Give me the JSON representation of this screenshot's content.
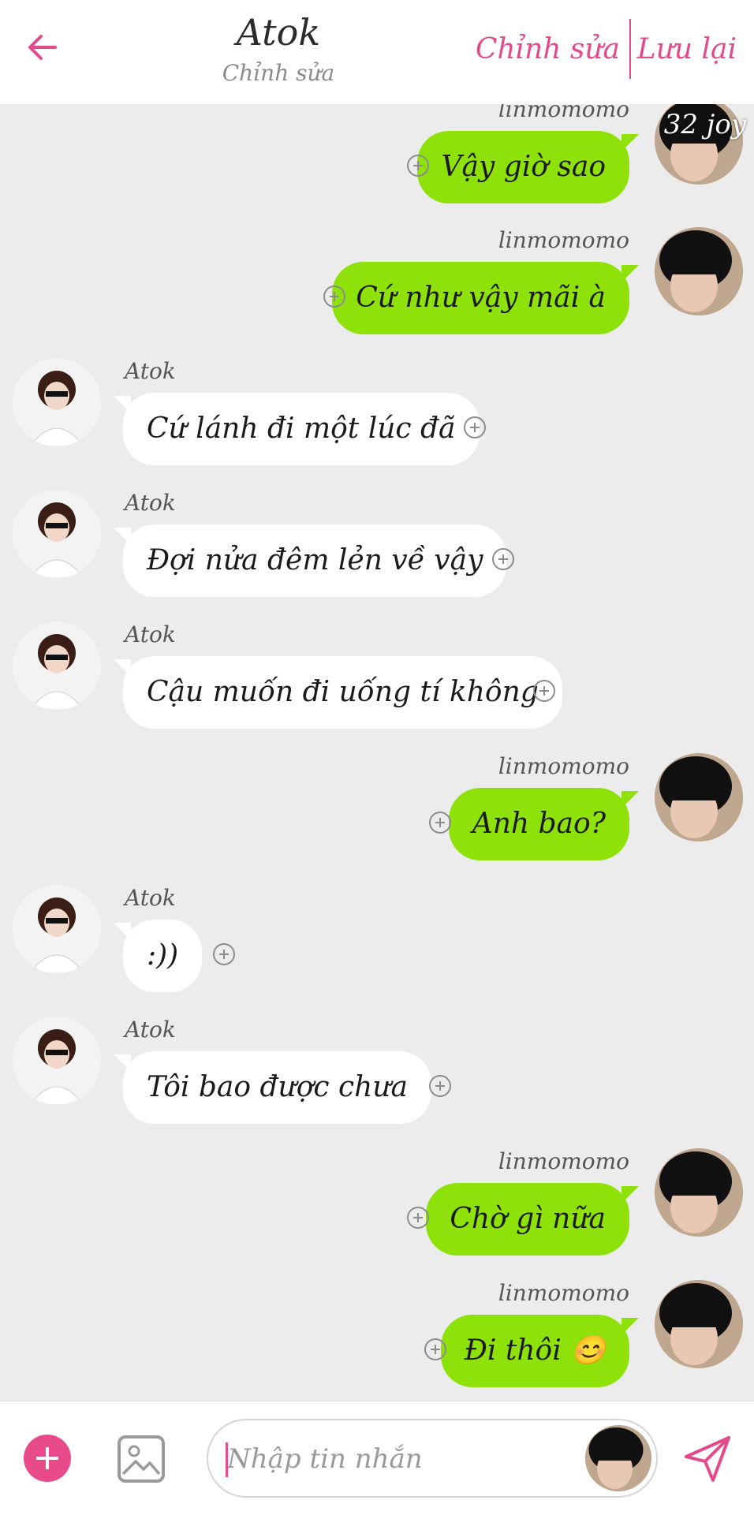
{
  "header": {
    "title": "Atok",
    "subtitle": "Chỉnh sửa",
    "edit_label": "Chỉnh sửa",
    "save_label": "Lưu lại",
    "accent_color": "#e34a8b"
  },
  "watermark": "32 joy",
  "messages": [
    {
      "side": "right",
      "sender": "linmomomo",
      "text": "Vậy giờ sao"
    },
    {
      "side": "right",
      "sender": "linmomomo",
      "text": "Cứ như vậy mãi à"
    },
    {
      "side": "left",
      "sender": "Atok",
      "text": "Cứ lánh đi một lúc đã"
    },
    {
      "side": "left",
      "sender": "Atok",
      "text": "Đợi nửa đêm lẻn về vậy"
    },
    {
      "side": "left",
      "sender": "Atok",
      "text": "Cậu muốn đi uống tí không"
    },
    {
      "side": "right",
      "sender": "linmomomo",
      "text": "Anh bao?"
    },
    {
      "side": "left",
      "sender": "Atok",
      "text": ":))"
    },
    {
      "side": "left",
      "sender": "Atok",
      "text": "Tôi bao được chưa"
    },
    {
      "side": "right",
      "sender": "linmomomo",
      "text": "Chờ gì nữa"
    },
    {
      "side": "right",
      "sender": "linmomomo",
      "text": "Đi thôi 😊"
    }
  ],
  "input": {
    "placeholder": "Nhập tin nhắn",
    "value": ""
  },
  "colors": {
    "sent_bubble": "#8ee20a",
    "received_bubble": "#ffffff",
    "background": "#ececec"
  },
  "icons": [
    "back-arrow-icon",
    "add-icon",
    "image-icon",
    "send-icon",
    "add-reaction-icon"
  ]
}
